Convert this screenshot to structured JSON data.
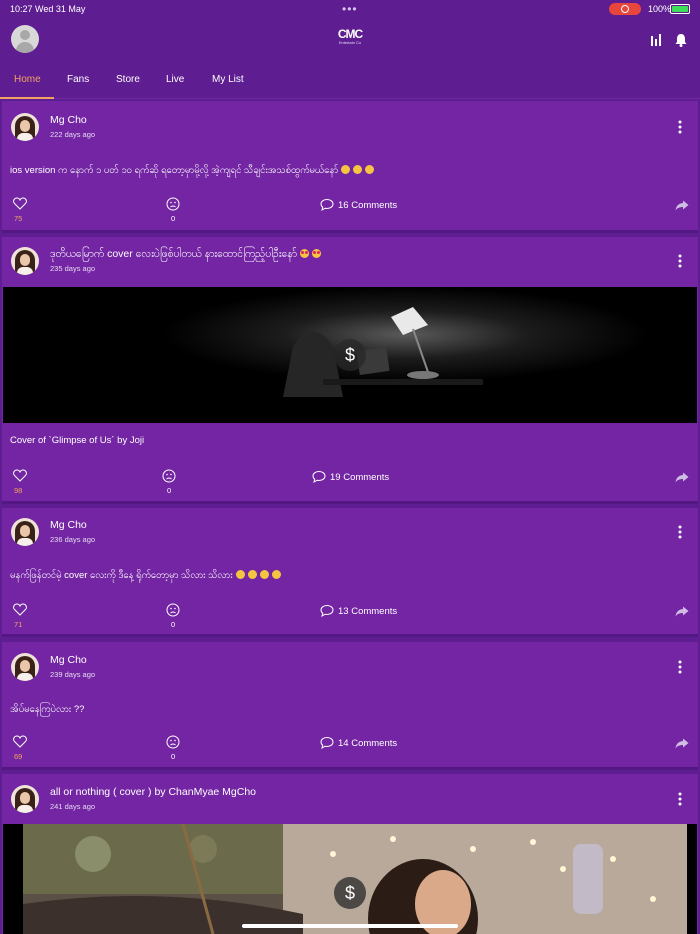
{
  "status_bar": {
    "time": "10:27  Wed 31 May",
    "battery": "100%"
  },
  "header": {
    "logo_text": "CMC",
    "logo_sub": "Entertain Co"
  },
  "tabs": [
    {
      "label": "Home",
      "active": true
    },
    {
      "label": "Fans",
      "active": false
    },
    {
      "label": "Store",
      "active": false
    },
    {
      "label": "Live",
      "active": false
    },
    {
      "label": "My List",
      "active": false
    }
  ],
  "posts": [
    {
      "author": "Mg Cho",
      "time_ago": "222 days ago",
      "text": "ios version က နောက် ၁ ပတ် ၁၀ ရက်ဆို ရတော့မှာမို့လို့ အဲ့ကျရင် သီချင်းအသစ်ထွက်မယ်နော်",
      "likes": "75",
      "sad": "0",
      "comments": "16 Comments"
    },
    {
      "author": "ဒုတိယမြောက် cover လေးပဲဖြစ်ပါတယ် နားထောင်ကြည့်ပါဦးနော်",
      "time_ago": "235 days ago",
      "media_symbol": "$",
      "text": "Cover of `Glimpse of Us´ by Joji",
      "likes": "98",
      "sad": "0",
      "comments": "19 Comments"
    },
    {
      "author": "Mg Cho",
      "time_ago": "236 days ago",
      "text": "မနက်ဖြန်တင်မဲ့ cover လေးကို ဒီနေ့ ရိုက်တော့မှာ သိလား သိလား",
      "likes": "71",
      "sad": "0",
      "comments": "13 Comments"
    },
    {
      "author": "Mg Cho",
      "time_ago": "239 days ago",
      "text": "အိပ်မနေကြပဲလား ??",
      "likes": "69",
      "sad": "0",
      "comments": "14 Comments"
    },
    {
      "author": "all or nothing ( cover ) by ChanMyae MgCho",
      "time_ago": "241 days ago",
      "media_symbol": "$"
    }
  ],
  "colors": {
    "background": "#5e1d91",
    "card": "#7325a3",
    "accent": "#f3a361"
  },
  "icons": [
    "profile-avatar-icon",
    "chart-icon",
    "bell-icon",
    "more-vertical-icon",
    "heart-icon",
    "sad-face-icon",
    "comment-icon",
    "share-icon",
    "dollar-icon"
  ]
}
